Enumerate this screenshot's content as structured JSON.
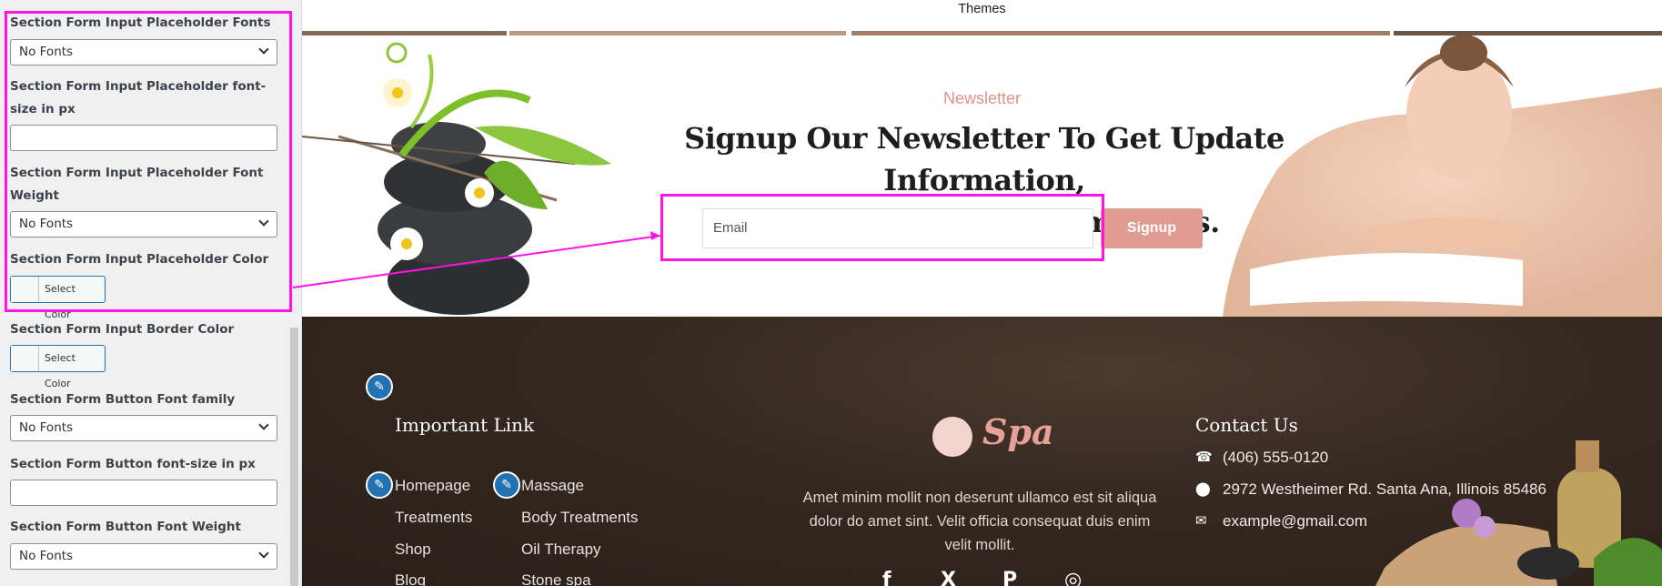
{
  "panel": {
    "controls": [
      {
        "label": "Section Form Input Placeholder Fonts",
        "type": "select",
        "value": "No Fonts"
      },
      {
        "label": "Section Form Input Placeholder font-size in px",
        "type": "text",
        "value": ""
      },
      {
        "label": "Section Form Input Placeholder Font Weight",
        "type": "select",
        "value": "No Fonts"
      },
      {
        "label": "Section Form Input Placeholder Color",
        "type": "color",
        "value": "Select Color"
      },
      {
        "label": "Section Form Input Border Color",
        "type": "color",
        "value": "Select Color"
      },
      {
        "label": "Section Form Button Font family",
        "type": "select",
        "value": "No Fonts"
      },
      {
        "label": "Section Form Button font-size in px",
        "type": "text",
        "value": ""
      },
      {
        "label": "Section Form Button Font Weight",
        "type": "select",
        "value": "No Fonts"
      }
    ]
  },
  "preview": {
    "top_bar": "Themes",
    "newsletter": {
      "eyebrow": "Newsletter",
      "headline_line1": "Signup Our Newsletter To Get Update Information,",
      "headline_line2": "News, Insight Or Promotions.",
      "email_placeholder": "Email",
      "button_label": "Signup"
    },
    "footer": {
      "important_link_title": "Important Link",
      "links_col1": [
        "Homepage",
        "Treatments",
        "Shop",
        "Blog"
      ],
      "links_col2": [
        "Massage",
        "Body Treatments",
        "Oil Therapy",
        "Stone spa"
      ],
      "logo_text": "Spa",
      "description": "Amet minim mollit non deserunt ullamco est sit aliqua dolor do amet sint. Velit officia consequat duis enim velit mollit.",
      "contact_title": "Contact Us",
      "phone": "(406) 555-0120",
      "address": "2972 Westheimer Rd. Santa Ana, Illinois 85486",
      "email": "example@gmail.com",
      "social_icons": [
        "facebook-icon",
        "x-icon",
        "pinterest-icon",
        "instagram-icon"
      ]
    }
  },
  "colors": {
    "highlight": "#ff14e8",
    "accent": "#e09c93",
    "footer_bg": "#34281f",
    "wp_blue": "#2271b1"
  }
}
